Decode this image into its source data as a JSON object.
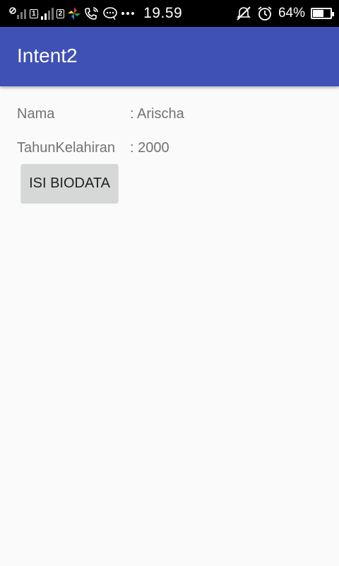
{
  "status_bar": {
    "time": "19.59",
    "battery_percent_label": "64%",
    "battery_level": 0.64,
    "sim1_label": "1",
    "sim2_label": "2",
    "icons": [
      "signal-icon",
      "sim1-signal-icon",
      "sim2-signal-icon",
      "pinwheel-app-icon",
      "wifi-call-icon",
      "chat-bubble-icon",
      "more-dots-icon",
      "mute-icon",
      "alarm-icon",
      "battery-icon"
    ]
  },
  "app_bar": {
    "title": "Intent2",
    "color": "#3f51b5"
  },
  "biodata": {
    "nama_label": "Nama",
    "nama_value": ": Arischa",
    "tahun_label": "TahunKelahiran",
    "tahun_value": ": 2000"
  },
  "isi_button": {
    "label": "ISI BIODATA"
  }
}
